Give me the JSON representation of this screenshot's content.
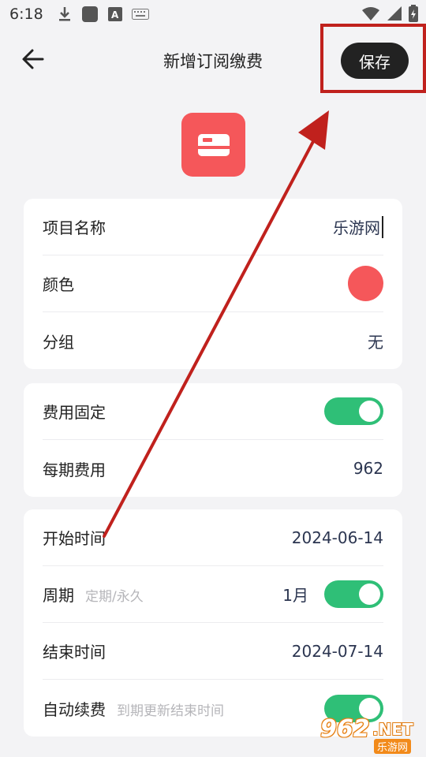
{
  "status_bar": {
    "time": "6:18",
    "icons": [
      "download-icon",
      "app-icon",
      "font-icon",
      "keyboard-icon",
      "wifi-icon",
      "signal-icon",
      "battery-icon"
    ]
  },
  "header": {
    "title": "新增订阅缴费",
    "save_label": "保存"
  },
  "colors": {
    "accent_red": "#f5575a",
    "toggle_green": "#2fbf77",
    "annotation_red": "#c0211d"
  },
  "card1": {
    "name_label": "项目名称",
    "name_value": "乐游网",
    "color_label": "颜色",
    "group_label": "分组",
    "group_value": "无"
  },
  "card2": {
    "fixed_label": "费用固定",
    "fixed_on": true,
    "cost_label": "每期费用",
    "cost_value": "962"
  },
  "card3": {
    "start_label": "开始时间",
    "start_value": "2024-06-14",
    "period_label": "周期",
    "period_hint": "定期/永久",
    "period_value": "1月",
    "period_on": true,
    "end_label": "结束时间",
    "end_value": "2024-07-14",
    "renew_label": "自动续费",
    "renew_hint": "到期更新结束时间",
    "renew_on": true
  },
  "watermark": {
    "big": "962",
    "net": ".NET",
    "small": "乐游网"
  }
}
